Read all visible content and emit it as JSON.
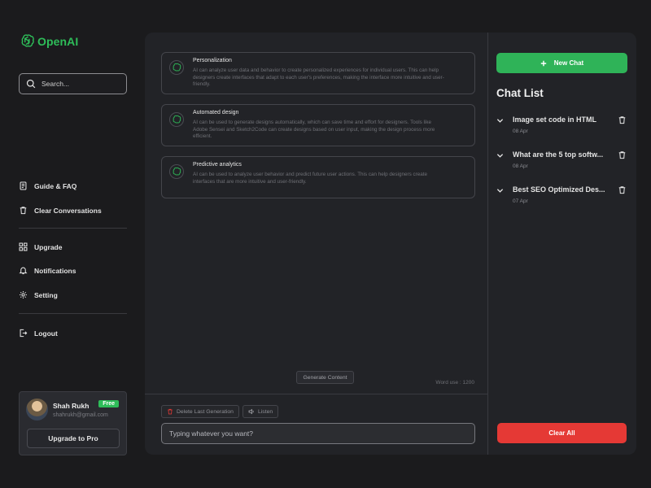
{
  "app": {
    "logo_text": "OpenAI",
    "accent": "#2ebd59"
  },
  "search": {
    "placeholder": "Search..."
  },
  "sidebar": {
    "items": [
      {
        "label": "Guide & FAQ",
        "icon": "document-icon"
      },
      {
        "label": "Clear Conversations",
        "icon": "trash-icon"
      },
      {
        "label": "Upgrade",
        "icon": "grid-icon"
      },
      {
        "label": "Notifications",
        "icon": "bell-icon"
      },
      {
        "label": "Setting",
        "icon": "gear-icon"
      },
      {
        "label": "Logout",
        "icon": "logout-icon"
      }
    ]
  },
  "profile": {
    "name": "Shah Rukh",
    "email": "shahrukh@gmail.com",
    "plan_badge": "Free",
    "upgrade_label": "Upgrade to Pro"
  },
  "cards": [
    {
      "title": "Personalization",
      "text": "AI can analyze user data and behavior to create personalized experiences for individual users. This can help designers create interfaces that adapt to each user's preferences, making the interface   more intuitive and user-friendly."
    },
    {
      "title": "Automated design",
      "text": "AI can be used to generate designs automatically, which can save time and effort for designers. Tools like Adobe Sensei and Sketch2Code can create designs based on user input, making the design process more efficient."
    },
    {
      "title": "Predictive analytics",
      "text": "AI can be used to analyze user behavior and predict future user actions. This can help designers create interfaces that are more intuitive and user-friendly."
    }
  ],
  "composer": {
    "generate_label": "Generate Content",
    "word_use": "Word use : 1200",
    "delete_label": "Delete Last Generation",
    "listen_label": "Listen",
    "input_placeholder": "Typing whatever you want?"
  },
  "right_panel": {
    "new_chat_label": "New Chat",
    "chat_list_title": "Chat List",
    "chats": [
      {
        "title": "Image set code in HTML",
        "date": "08 Apr"
      },
      {
        "title": "What are the 5 top softw...",
        "date": "08 Apr"
      },
      {
        "title": "Best SEO Optimized Des...",
        "date": "07 Apr"
      }
    ],
    "clear_all_label": "Clear All",
    "clear_color": "#e53935"
  }
}
